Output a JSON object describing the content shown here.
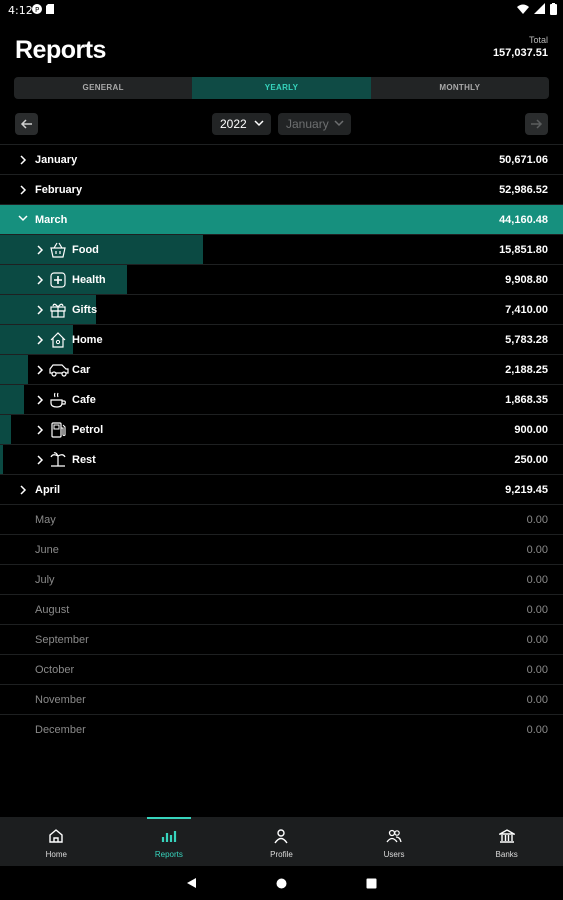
{
  "status_bar": {
    "time": "4:12"
  },
  "header": {
    "title": "Reports",
    "total_label": "Total",
    "total_value": "157,037.51"
  },
  "tabs": [
    {
      "label": "GENERAL",
      "active": false
    },
    {
      "label": "YEARLY",
      "active": true
    },
    {
      "label": "MONTHLY",
      "active": false
    }
  ],
  "filters": {
    "year": "2022",
    "month": "January"
  },
  "months": [
    {
      "label": "January",
      "value": "50,671.06"
    },
    {
      "label": "February",
      "value": "52,986.52"
    },
    {
      "label": "March",
      "value": "44,160.48"
    },
    {
      "label": "April",
      "value": "9,219.45"
    },
    {
      "label": "May",
      "value": "0.00"
    },
    {
      "label": "June",
      "value": "0.00"
    },
    {
      "label": "July",
      "value": "0.00"
    },
    {
      "label": "August",
      "value": "0.00"
    },
    {
      "label": "September",
      "value": "0.00"
    },
    {
      "label": "October",
      "value": "0.00"
    },
    {
      "label": "November",
      "value": "0.00"
    },
    {
      "label": "December",
      "value": "0.00"
    }
  ],
  "march_categories": [
    {
      "label": "Food",
      "value": "15,851.80",
      "icon": "basket-icon",
      "share": 0.36
    },
    {
      "label": "Health",
      "value": "9,908.80",
      "icon": "health-icon",
      "share": 0.225
    },
    {
      "label": "Gifts",
      "value": "7,410.00",
      "icon": "gift-icon",
      "share": 0.17
    },
    {
      "label": "Home",
      "value": "5,783.28",
      "icon": "home-icon",
      "share": 0.13
    },
    {
      "label": "Car",
      "value": "2,188.25",
      "icon": "car-icon",
      "share": 0.05
    },
    {
      "label": "Cafe",
      "value": "1,868.35",
      "icon": "coffee-icon",
      "share": 0.043
    },
    {
      "label": "Petrol",
      "value": "900.00",
      "icon": "fuel-icon",
      "share": 0.02
    },
    {
      "label": "Rest",
      "value": "250.00",
      "icon": "beach-icon",
      "share": 0.006
    }
  ],
  "bottom_nav": [
    {
      "label": "Home",
      "icon": "home-icon",
      "active": false
    },
    {
      "label": "Reports",
      "icon": "bar-chart-icon",
      "active": true
    },
    {
      "label": "Profile",
      "icon": "person-icon",
      "active": false
    },
    {
      "label": "Users",
      "icon": "users-icon",
      "active": false
    },
    {
      "label": "Banks",
      "icon": "bank-icon",
      "active": false
    }
  ],
  "colors": {
    "accent": "#37d4bd",
    "active_row": "#16907e",
    "bar": "#0b4a43",
    "tab_active_bg": "#0f4b45"
  }
}
